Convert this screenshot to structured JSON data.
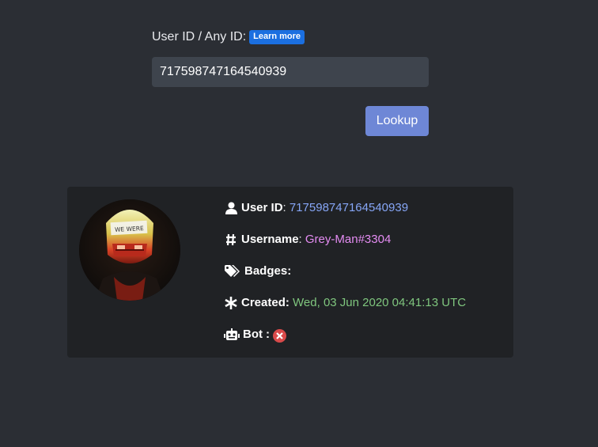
{
  "form": {
    "label": "User ID / Any ID:",
    "learn_more": "Learn more",
    "input_value": "717598747164540939",
    "lookup_button": "Lookup"
  },
  "result": {
    "user_id_label": "User ID",
    "user_id_value": "717598747164540939",
    "username_label": "Username",
    "username_value": "Grey-Man#3304",
    "badges_label": "Badges",
    "created_label": "Created",
    "created_value": "Wed, 03 Jun 2020 04:41:13 UTC",
    "bot_label": "Bot",
    "bot_value": false,
    "avatar_text": "WE WERE"
  },
  "icons": {
    "user": "user-icon",
    "username": "hashtag-icon",
    "badges": "tags-icon",
    "created": "asterisk-icon",
    "bot": "robot-icon",
    "bot_status": "x-circle-icon"
  },
  "colors": {
    "background": "#2b2e34",
    "card": "#202225",
    "input": "#3e444d",
    "button": "#6e87d6",
    "learn_more": "#1b6fe0",
    "user_id": "#86a6f6",
    "username": "#e48cf2",
    "created": "#7fc67e",
    "bot_false": "#d94a4a"
  }
}
